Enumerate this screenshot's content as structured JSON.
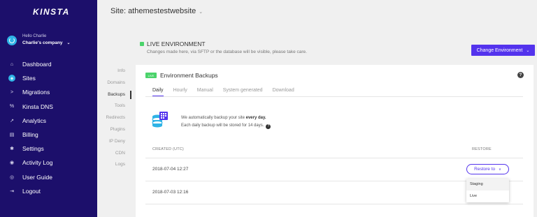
{
  "sidebar": {
    "logo": "KINSTA",
    "user": {
      "greeting": "Hello Charlie",
      "company": "Charlie's company"
    },
    "items": [
      {
        "label": "Dashboard",
        "icon": "home-icon",
        "glyph": "⌂"
      },
      {
        "label": "Sites",
        "icon": "sites-icon",
        "glyph": "◈",
        "active": true
      },
      {
        "label": "Migrations",
        "icon": "migrations-icon",
        "glyph": ">"
      },
      {
        "label": "Kinsta DNS",
        "icon": "dns-icon",
        "glyph": "%"
      },
      {
        "label": "Analytics",
        "icon": "analytics-icon",
        "glyph": "↗"
      },
      {
        "label": "Billing",
        "icon": "billing-icon",
        "glyph": "▤"
      },
      {
        "label": "Settings",
        "icon": "settings-icon",
        "glyph": "✱"
      },
      {
        "label": "Activity Log",
        "icon": "activity-log-icon",
        "glyph": "◉"
      },
      {
        "label": "User Guide",
        "icon": "user-guide-icon",
        "glyph": "◎"
      },
      {
        "label": "Logout",
        "icon": "logout-icon",
        "glyph": "⇥"
      }
    ]
  },
  "header": {
    "site_title": "Site: athemestestwebsite"
  },
  "environment": {
    "title": "LIVE ENVIRONMENT",
    "subtitle": "Changes made here, via SFTP or the database will be visible, please take care.",
    "change_button": "Change Environment"
  },
  "subnav": [
    "Info",
    "Domains",
    "Backups",
    "Tools",
    "Redirects",
    "Plugins",
    "IP Deny",
    "CDN",
    "Logs"
  ],
  "panel": {
    "badge": "LIVE",
    "title": "Environment Backups",
    "tabs": [
      "Daily",
      "Hourly",
      "Manual",
      "System generated",
      "Download"
    ],
    "info_line1_pre": "We automatically backup your site ",
    "info_line1_bold": "every day.",
    "info_line2": "Each daily backup will be stored for 14 days.",
    "col_created": "CREATED (UTC)",
    "col_restore": "RESTORE",
    "rows": [
      "2018-07-04 12:27",
      "2018-07-03 12:16"
    ],
    "restore_button": "Restore to",
    "dropdown": [
      "Staging",
      "Live"
    ]
  },
  "colors": {
    "sidebar": "#1c0f6b",
    "accent": "#5333ed",
    "live": "#4bd36b",
    "sites_icon": "#2fb3e6"
  }
}
